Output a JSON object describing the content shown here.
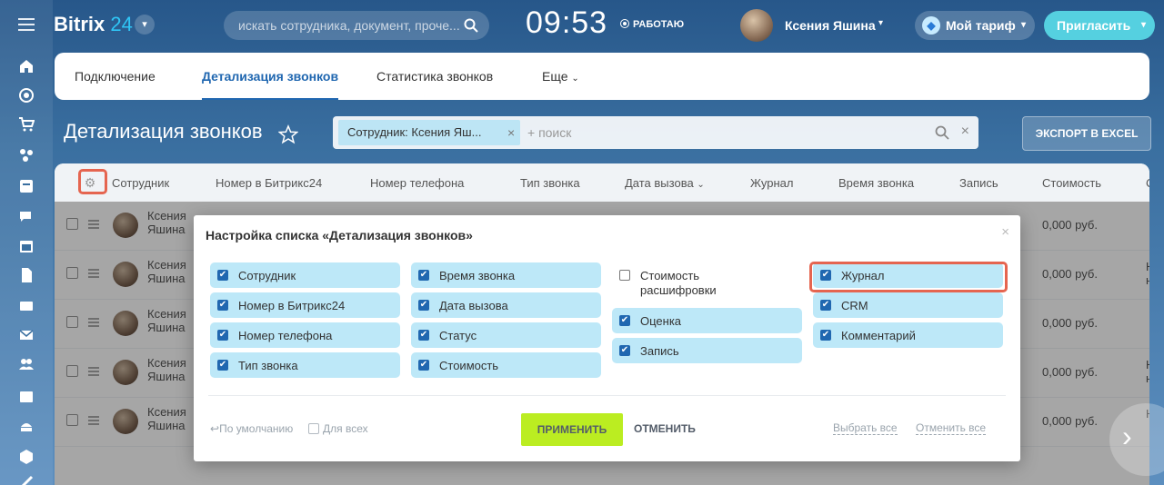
{
  "header": {
    "logo_brand": "Bitrix",
    "logo_num": "24",
    "search_placeholder": "искать сотрудника, документ, проче...",
    "time": "09:53",
    "status": "РАБОТАЮ",
    "user_name": "Ксения Яшина",
    "tarif": "Мой тариф",
    "invite": "Пригласить"
  },
  "tabs": [
    "Подключение",
    "Детализация звонков",
    "Статистика звонков",
    "Еще"
  ],
  "page": {
    "title": "Детализация звонков",
    "filter_chip": "Сотрудник: Ксения Яш...",
    "filter_placeholder": "+ поиск",
    "export": "ЭКСПОРТ В EXCEL"
  },
  "grid": {
    "columns": [
      "Сотрудник",
      "Номер в Битрикс24",
      "Номер телефона",
      "Тип звонка",
      "Дата вызова",
      "Журнал",
      "Время звонка",
      "Запись",
      "Стоимость",
      "С"
    ],
    "rows": [
      {
        "name": "Ксения Яшина",
        "cost": "0,000 руб.",
        "extra": ""
      },
      {
        "name": "Ксения Яшина",
        "cost": "0,000 руб.",
        "extra": "Н\nн"
      },
      {
        "name": "Ксения Яшина",
        "cost": "0,000 руб.",
        "extra": ""
      },
      {
        "name": "Ксения Яшина",
        "cost": "0,000 руб.",
        "extra": "Н\nн"
      },
      {
        "name": "Ксения Яшина",
        "cost": "0,000 руб.",
        "extra": "Н"
      }
    ]
  },
  "modal": {
    "title": "Настройка списка «Детализация звонков»",
    "options": [
      {
        "label": "Сотрудник",
        "checked": true
      },
      {
        "label": "Номер в Битрикс24",
        "checked": true
      },
      {
        "label": "Номер телефона",
        "checked": true
      },
      {
        "label": "Тип звонка",
        "checked": true
      },
      {
        "label": "Время звонка",
        "checked": true
      },
      {
        "label": "Дата вызова",
        "checked": true
      },
      {
        "label": "Статус",
        "checked": true
      },
      {
        "label": "Стоимость",
        "checked": true
      },
      {
        "label": "Стоимость расшифровки",
        "checked": false
      },
      {
        "label": "Оценка",
        "checked": true
      },
      {
        "label": "Запись",
        "checked": true
      },
      {
        "label": "Журнал",
        "checked": true
      },
      {
        "label": "CRM",
        "checked": true
      },
      {
        "label": "Комментарий",
        "checked": true
      }
    ],
    "default_link": "По умолчанию",
    "for_all": "Для всех",
    "apply": "ПРИМЕНИТЬ",
    "cancel": "ОТМЕНИТЬ",
    "select_all": "Выбрать все",
    "unselect_all": "Отменить все"
  },
  "colors": {
    "accent": "#2067b0",
    "apply": "#bbed21",
    "highlight": "#e56550",
    "option_bg": "#bde8f8"
  }
}
